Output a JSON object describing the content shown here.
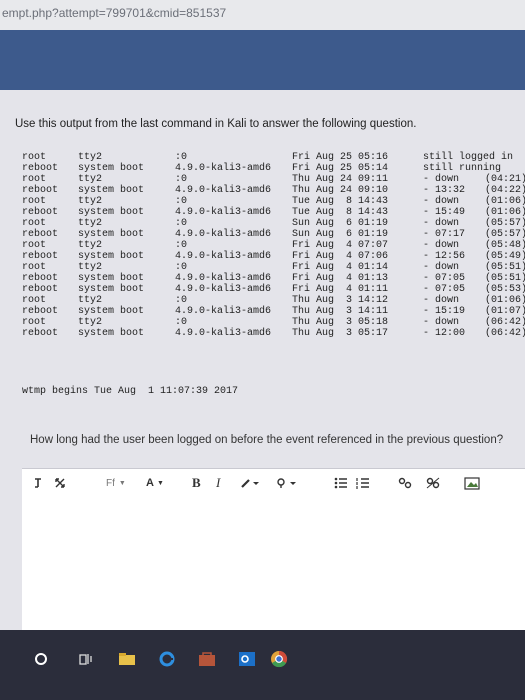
{
  "browser": {
    "url": "empt.php?attempt=799701&cmid=851537"
  },
  "question": {
    "header": "Use this output from the last command in Kali to answer the following question.",
    "prompt": "How long had the user been logged on before the event referenced in the previous question?"
  },
  "terminal": {
    "rows": [
      {
        "user": "root",
        "tty": "tty2",
        "host": ":0",
        "login": "Fri Aug 25 05:16",
        "end": "still logged in",
        "dur": ""
      },
      {
        "user": "reboot",
        "tty": "system boot",
        "host": "4.9.0-kali3-amd6",
        "login": "Fri Aug 25 05:14",
        "end": "still running",
        "dur": ""
      },
      {
        "user": "root",
        "tty": "tty2",
        "host": ":0",
        "login": "Thu Aug 24 09:11",
        "end": "- down",
        "dur": "(04:21)"
      },
      {
        "user": "reboot",
        "tty": "system boot",
        "host": "4.9.0-kali3-amd6",
        "login": "Thu Aug 24 09:10",
        "end": "- 13:32",
        "dur": "(04:22)"
      },
      {
        "user": "root",
        "tty": "tty2",
        "host": ":0",
        "login": "Tue Aug  8 14:43",
        "end": "- down",
        "dur": "(01:06)"
      },
      {
        "user": "reboot",
        "tty": "system boot",
        "host": "4.9.0-kali3-amd6",
        "login": "Tue Aug  8 14:43",
        "end": "- 15:49",
        "dur": "(01:06)"
      },
      {
        "user": "root",
        "tty": "tty2",
        "host": ":0",
        "login": "Sun Aug  6 01:19",
        "end": "- down",
        "dur": "(05:57)"
      },
      {
        "user": "reboot",
        "tty": "system boot",
        "host": "4.9.0-kali3-amd6",
        "login": "Sun Aug  6 01:19",
        "end": "- 07:17",
        "dur": "(05:57)"
      },
      {
        "user": "root",
        "tty": "tty2",
        "host": ":0",
        "login": "Fri Aug  4 07:07",
        "end": "- down",
        "dur": "(05:48)"
      },
      {
        "user": "reboot",
        "tty": "system boot",
        "host": "4.9.0-kali3-amd6",
        "login": "Fri Aug  4 07:06",
        "end": "- 12:56",
        "dur": "(05:49)"
      },
      {
        "user": "root",
        "tty": "tty2",
        "host": ":0",
        "login": "Fri Aug  4 01:14",
        "end": "- down",
        "dur": "(05:51)"
      },
      {
        "user": "reboot",
        "tty": "system boot",
        "host": "4.9.0-kali3-amd6",
        "login": "Fri Aug  4 01:13",
        "end": "- 07:05",
        "dur": "(05:51)"
      },
      {
        "user": "reboot",
        "tty": "system boot",
        "host": "4.9.0-kali3-amd6",
        "login": "Fri Aug  4 01:11",
        "end": "- 07:05",
        "dur": "(05:53)"
      },
      {
        "user": "root",
        "tty": "tty2",
        "host": ":0",
        "login": "Thu Aug  3 14:12",
        "end": "- down",
        "dur": "(01:06)"
      },
      {
        "user": "reboot",
        "tty": "system boot",
        "host": "4.9.0-kali3-amd6",
        "login": "Thu Aug  3 14:11",
        "end": "- 15:19",
        "dur": "(01:07)"
      },
      {
        "user": "root",
        "tty": "tty2",
        "host": ":0",
        "login": "Thu Aug  3 05:18",
        "end": "- down",
        "dur": "(06:42)"
      },
      {
        "user": "reboot",
        "tty": "system boot",
        "host": "4.9.0-kali3-amd6",
        "login": "Thu Aug  3 05:17",
        "end": "- 12:00",
        "dur": "(06:42)"
      }
    ],
    "footer": "wtmp begins Tue Aug  1 11:07:39 2017"
  },
  "toolbar": {
    "font_family_label": "Ff",
    "bold_label": "B",
    "italic_label": "I",
    "font_size_label": "A"
  },
  "colors": {
    "banner": "#3d5a8c",
    "page": "#e4e4ea",
    "taskbar": "#2b2d3b"
  }
}
